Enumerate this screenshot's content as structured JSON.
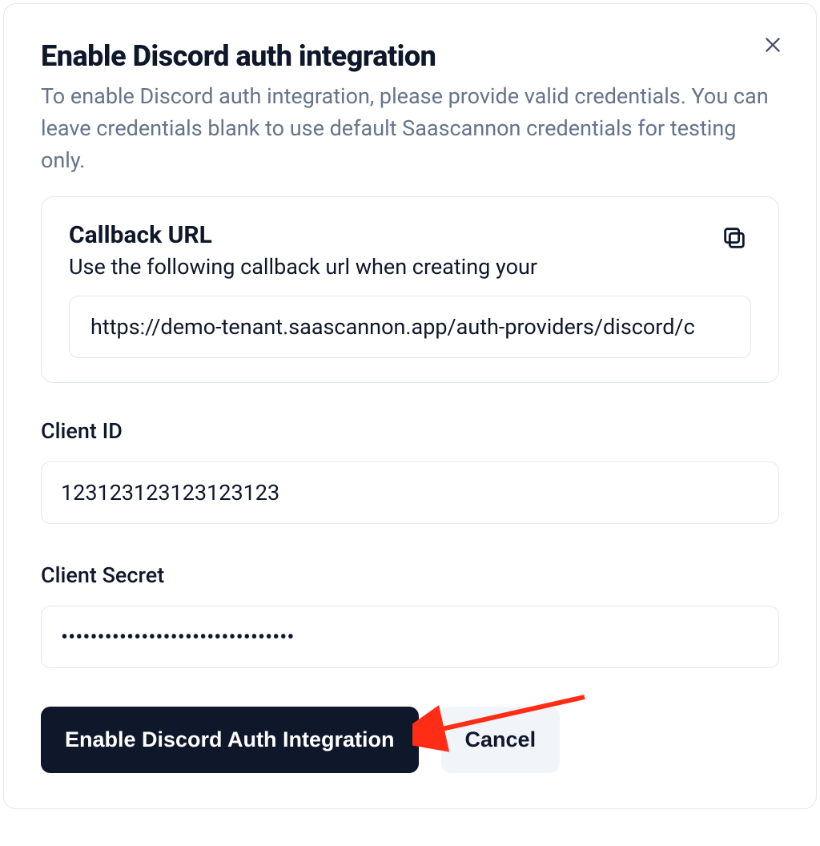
{
  "modal": {
    "title": "Enable Discord auth integration",
    "description": "To enable Discord auth integration, please provide valid credentials. You can leave credentials blank to use default Saascannon credentials for testing only."
  },
  "callback": {
    "title": "Callback URL",
    "subtitle": "Use the following callback url when creating your",
    "url": "https://demo-tenant.saascannon.app/auth-providers/discord/c"
  },
  "fields": {
    "client_id": {
      "label": "Client ID",
      "value": "123123123123123123"
    },
    "client_secret": {
      "label": "Client Secret",
      "value": "................................"
    }
  },
  "actions": {
    "primary_label": "Enable Discord Auth Integration",
    "cancel_label": "Cancel"
  }
}
